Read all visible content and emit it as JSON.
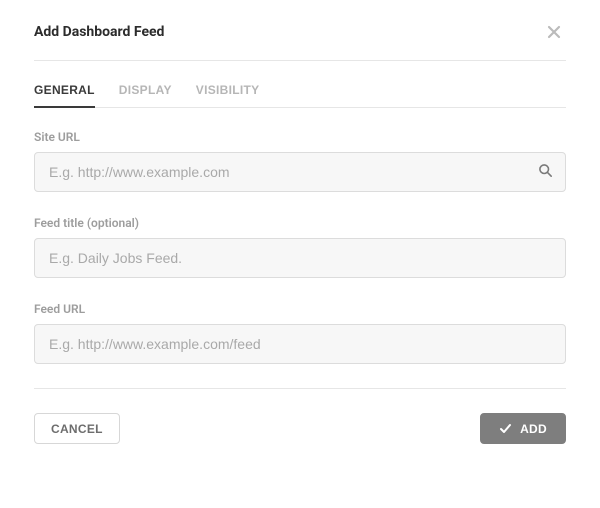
{
  "modal": {
    "title": "Add Dashboard Feed"
  },
  "tabs": [
    {
      "label": "GENERAL",
      "active": true
    },
    {
      "label": "DISPLAY",
      "active": false
    },
    {
      "label": "VISIBILITY",
      "active": false
    }
  ],
  "fields": {
    "site_url": {
      "label": "Site URL",
      "placeholder": "E.g. http://www.example.com",
      "value": ""
    },
    "feed_title": {
      "label": "Feed title (optional)",
      "placeholder": "E.g. Daily Jobs Feed.",
      "value": ""
    },
    "feed_url": {
      "label": "Feed URL",
      "placeholder": "E.g. http://www.example.com/feed",
      "value": ""
    }
  },
  "actions": {
    "cancel": "CANCEL",
    "submit": "ADD"
  },
  "icons": {
    "close": "close-icon",
    "search": "search-icon",
    "check": "check-icon"
  }
}
